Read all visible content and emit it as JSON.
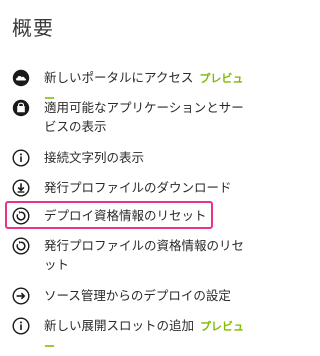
{
  "title": "概要",
  "preview_badge": "プレビュー",
  "accent_color": "#e8338a",
  "preview_color": "#7fba00",
  "items": [
    {
      "label": "新しいポータルにアクセス",
      "icon": "cloud-icon",
      "preview": true
    },
    {
      "label": "適用可能なアプリケーションとサービスの表示",
      "icon": "bag-icon",
      "preview": false
    },
    {
      "label": "接続文字列の表示",
      "icon": "info-icon",
      "preview": false
    },
    {
      "label": "発行プロファイルのダウンロード",
      "icon": "download-icon",
      "preview": false
    },
    {
      "label": "デプロイ資格情報のリセット",
      "icon": "reset-icon",
      "preview": false,
      "highlighted": true
    },
    {
      "label": "発行プロファイルの資格情報のリセット",
      "icon": "reset-icon",
      "preview": false
    },
    {
      "label": "ソース管理からのデプロイの設定",
      "icon": "arrow-right-icon",
      "preview": false
    },
    {
      "label": "新しい展開スロットの追加",
      "icon": "info-icon",
      "preview": true
    }
  ]
}
